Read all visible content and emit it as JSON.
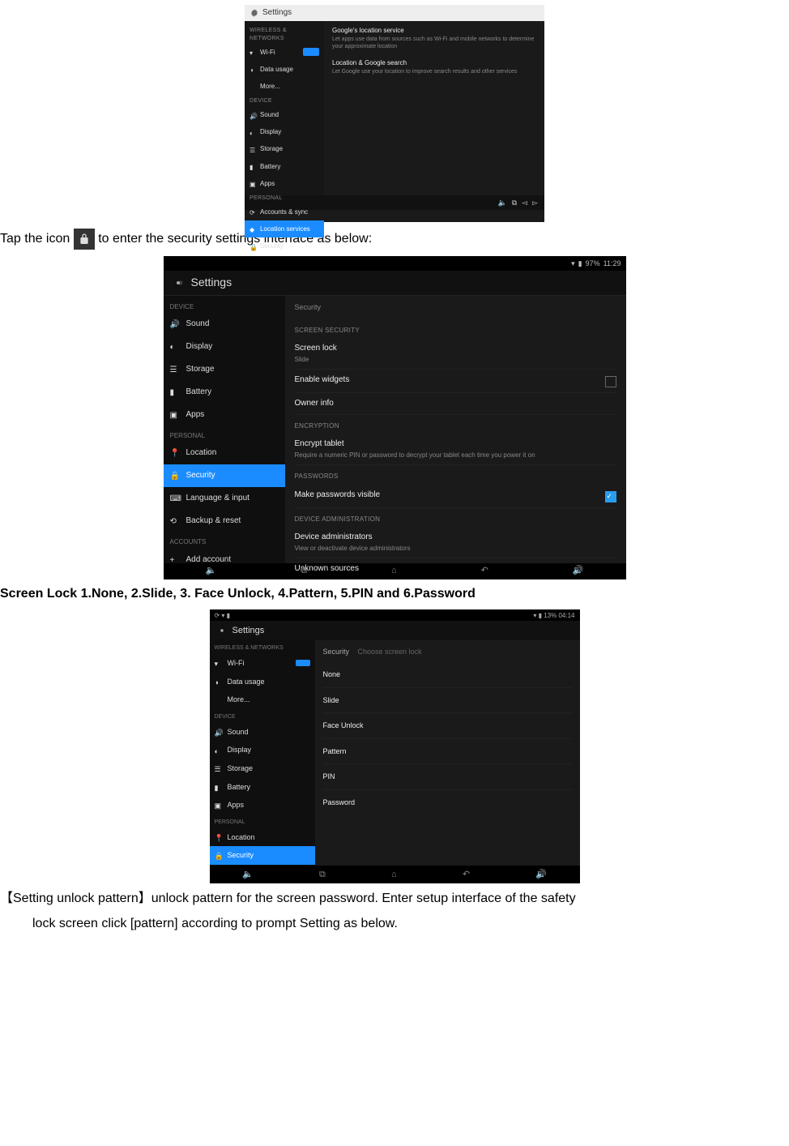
{
  "doc": {
    "tap_line_pre": "Tap the icon",
    "tap_line_post": " to enter the security settings interface as below:",
    "screenlock_heading": "Screen Lock 1.None, 2.Slide, 3. Face Unlock, 4.Pattern, 5.PIN and      6.Password",
    "pattern_line1": "【Setting unlock pattern】unlock pattern for the screen password. Enter setup interface of the safety",
    "pattern_line2": "lock screen click [pattern] according to prompt Setting as below."
  },
  "ss1": {
    "title": "Settings",
    "side_sections": {
      "wireless": "WIRELESS & NETWORKS",
      "device": "DEVICE",
      "personal": "PERSONAL"
    },
    "side": {
      "wifi": "Wi-Fi",
      "data_usage": "Data usage",
      "more": "More...",
      "sound": "Sound",
      "display": "Display",
      "storage": "Storage",
      "battery": "Battery",
      "apps": "Apps",
      "accounts_sync": "Accounts & sync",
      "location": "Location services",
      "security": "Security"
    },
    "content": {
      "gls": {
        "h": "Google's location service",
        "d": "Let apps use data from sources such as Wi-Fi and mobile networks to determine your approximate location"
      },
      "lgs": {
        "h": "Location & Google search",
        "d": "Let Google use your location to improve search results and other services"
      }
    }
  },
  "ss2": {
    "status": {
      "batt": "97%",
      "time": "11:29"
    },
    "title": "Settings",
    "side_sections": {
      "device": "DEVICE",
      "personal": "PERSONAL",
      "accounts": "ACCOUNTS"
    },
    "side": {
      "sound": "Sound",
      "display": "Display",
      "storage": "Storage",
      "battery": "Battery",
      "apps": "Apps",
      "location": "Location",
      "security": "Security",
      "lang": "Language & input",
      "backup": "Backup & reset",
      "add_acct": "Add account"
    },
    "content": {
      "header": "Security",
      "sec1": "SCREEN SECURITY",
      "screen_lock": {
        "h": "Screen lock",
        "d": "Slide"
      },
      "enable_widgets": {
        "h": "Enable widgets"
      },
      "owner_info": {
        "h": "Owner info"
      },
      "sec2": "ENCRYPTION",
      "encrypt": {
        "h": "Encrypt tablet",
        "d": "Require a numeric PIN or password to decrypt your tablet each time you power it on"
      },
      "sec3": "PASSWORDS",
      "pwvis": {
        "h": "Make passwords visible"
      },
      "sec4": "DEVICE ADMINISTRATION",
      "devadmin": {
        "h": "Device administrators",
        "d": "View or deactivate device administrators"
      },
      "unknown": {
        "h": "Unknown sources"
      }
    }
  },
  "ss3": {
    "status": {
      "batt": "13%",
      "time": "04:14"
    },
    "title": "Settings",
    "side_sections": {
      "wireless": "WIRELESS & NETWORKS",
      "device": "DEVICE",
      "personal": "PERSONAL"
    },
    "side": {
      "wifi": "Wi-Fi",
      "data_usage": "Data usage",
      "more": "More...",
      "sound": "Sound",
      "display": "Display",
      "storage": "Storage",
      "battery": "Battery",
      "apps": "Apps",
      "location": "Location",
      "security": "Security"
    },
    "content": {
      "header": "Security",
      "breadcrumb": "Choose screen lock",
      "options": {
        "none": "None",
        "slide": "Slide",
        "face": "Face Unlock",
        "pattern": "Pattern",
        "pin": "PIN",
        "password": "Password"
      }
    }
  }
}
